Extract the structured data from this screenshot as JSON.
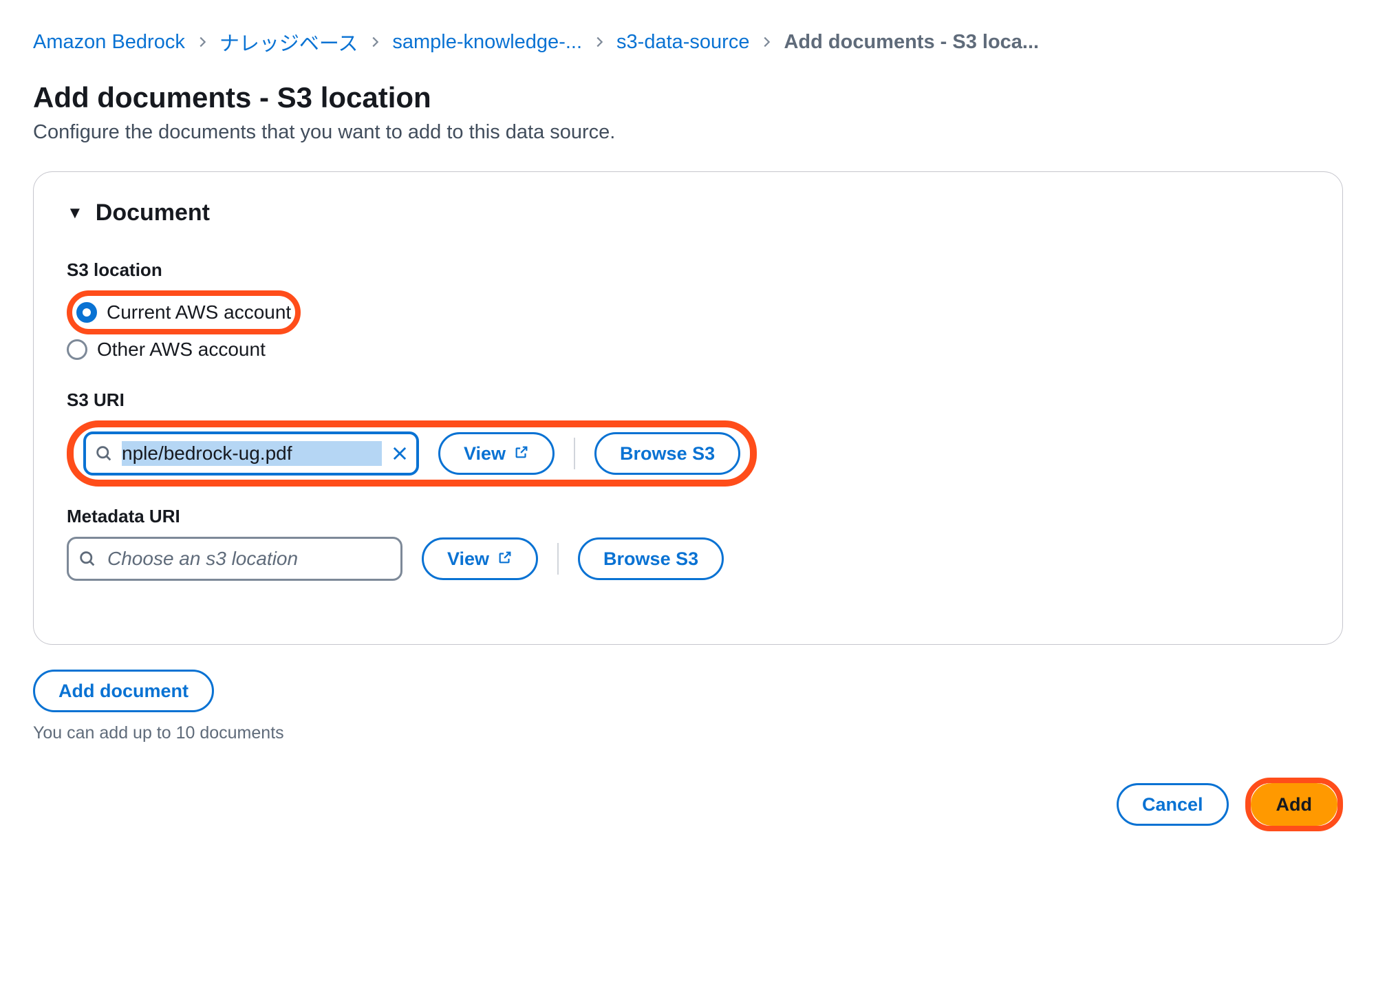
{
  "breadcrumb": {
    "items": [
      {
        "label": "Amazon Bedrock",
        "link": true
      },
      {
        "label": "ナレッジベース",
        "link": true
      },
      {
        "label": "sample-knowledge-...",
        "link": true
      },
      {
        "label": "s3-data-source",
        "link": true
      },
      {
        "label": "Add documents - S3 loca...",
        "link": false
      }
    ]
  },
  "page": {
    "title": "Add documents - S3 location",
    "subtitle": "Configure the documents that you want to add to this data source."
  },
  "panel": {
    "title": "Document",
    "s3_location": {
      "label": "S3 location",
      "options": {
        "current": "Current AWS account",
        "other": "Other AWS account"
      },
      "selected": "current"
    },
    "s3_uri": {
      "label": "S3 URI",
      "value": "nple/bedrock-ug.pdf",
      "view_label": "View",
      "browse_label": "Browse S3"
    },
    "metadata_uri": {
      "label": "Metadata URI",
      "placeholder": "Choose an s3 location",
      "view_label": "View",
      "browse_label": "Browse S3"
    }
  },
  "below": {
    "add_document_label": "Add document",
    "hint": "You can add up to 10 documents"
  },
  "footer": {
    "cancel_label": "Cancel",
    "add_label": "Add"
  }
}
